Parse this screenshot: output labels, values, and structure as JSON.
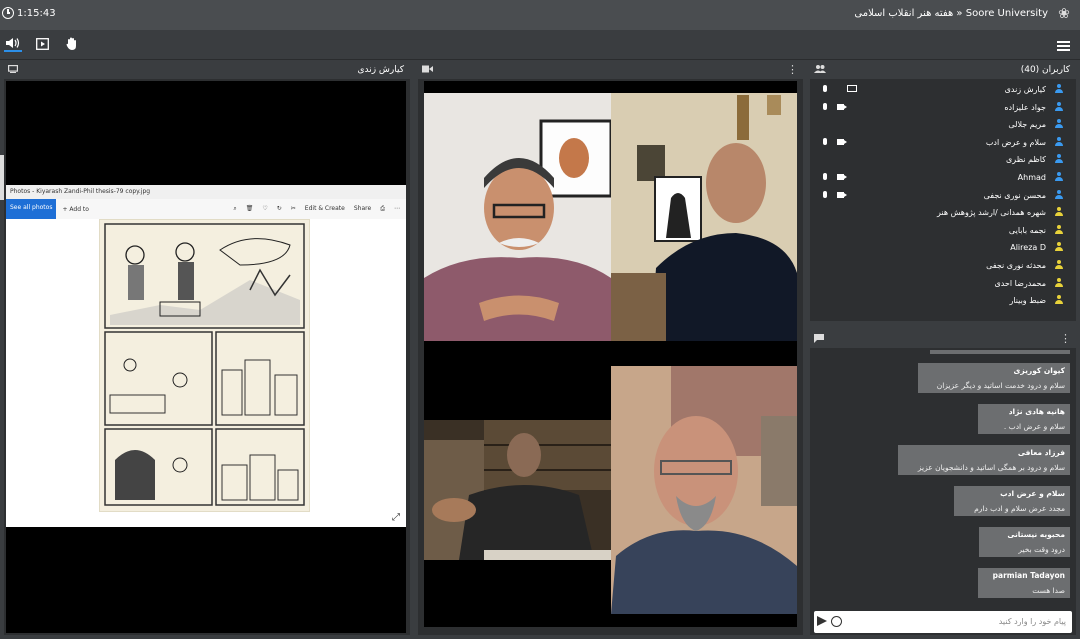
{
  "topbar": {
    "clock": "1:15:43",
    "title": "Soore University « هفته هنر انقلاب اسلامی"
  },
  "toolbar": {
    "speaker_icon": "speaker-icon",
    "share_icon": "play-box-icon",
    "hand_icon": "raise-hand-icon",
    "menu_icon": "hamburger-icon"
  },
  "share_panel": {
    "title": "کیارش زندی",
    "photos_window": {
      "title": "Photos - Kiyarash Zandi-Phil thesis-79 copy.jpg",
      "see_all": "See all photos",
      "add_to": "Add to",
      "edit_create": "Edit & Create",
      "share": "Share"
    }
  },
  "users_panel": {
    "title": "کاربران (40)",
    "users": [
      {
        "name": "کیارش زندی",
        "color": "#3a9af0",
        "mic": true,
        "cam": false,
        "screen": true
      },
      {
        "name": "جواد علیزاده",
        "color": "#3a9af0",
        "mic": true,
        "cam": true,
        "screen": false
      },
      {
        "name": "مریم جلالی",
        "color": "#3a9af0",
        "mic": false,
        "cam": false,
        "screen": false
      },
      {
        "name": "سلام و عرض ادب",
        "color": "#3a9af0",
        "mic": true,
        "cam": true,
        "screen": false
      },
      {
        "name": "کاظم نظری",
        "color": "#3a9af0",
        "mic": false,
        "cam": false,
        "screen": false
      },
      {
        "name": "Ahmad",
        "color": "#3a9af0",
        "mic": true,
        "cam": true,
        "screen": false
      },
      {
        "name": "محسن نوری نجفی",
        "color": "#3a9af0",
        "mic": true,
        "cam": true,
        "screen": false
      },
      {
        "name": "شهره همدانی /ارشد پژوهش هنر",
        "color": "#e8d23a",
        "mic": false,
        "cam": false,
        "screen": false
      },
      {
        "name": "نجمه بابایی",
        "color": "#e8d23a",
        "mic": false,
        "cam": false,
        "screen": false
      },
      {
        "name": "Alireza D",
        "color": "#e8d23a",
        "mic": false,
        "cam": false,
        "screen": false
      },
      {
        "name": "محدثه نوری نجفی",
        "color": "#e8d23a",
        "mic": false,
        "cam": false,
        "screen": false
      },
      {
        "name": "محمدرضا احدی",
        "color": "#e8d23a",
        "mic": false,
        "cam": false,
        "screen": false
      },
      {
        "name": "ضبط وبینار",
        "color": "#e8d23a",
        "mic": false,
        "cam": false,
        "screen": false
      }
    ]
  },
  "chat_panel": {
    "messages": [
      {
        "name": "کیوان کوریزی",
        "text": "سلام و درود خدمت اساتید و دیگر عزیزان"
      },
      {
        "name": "هانیه هادی نژاد",
        "text": "سلام و عرض ادب ."
      },
      {
        "name": "فرزاد معافی",
        "text": "سلام و درود بر همگی اساتید و دانشجویان عزیز"
      },
      {
        "name": "سلام و عرض ادب",
        "text": "مجدد عرض سلام و ادب دارم"
      },
      {
        "name": "محبوبه نیستانی",
        "text": "درود وقت بخیر"
      },
      {
        "name": "parmian Tadayon",
        "text": "صدا هست"
      }
    ],
    "input_placeholder": "پیام خود را وارد کنید"
  }
}
